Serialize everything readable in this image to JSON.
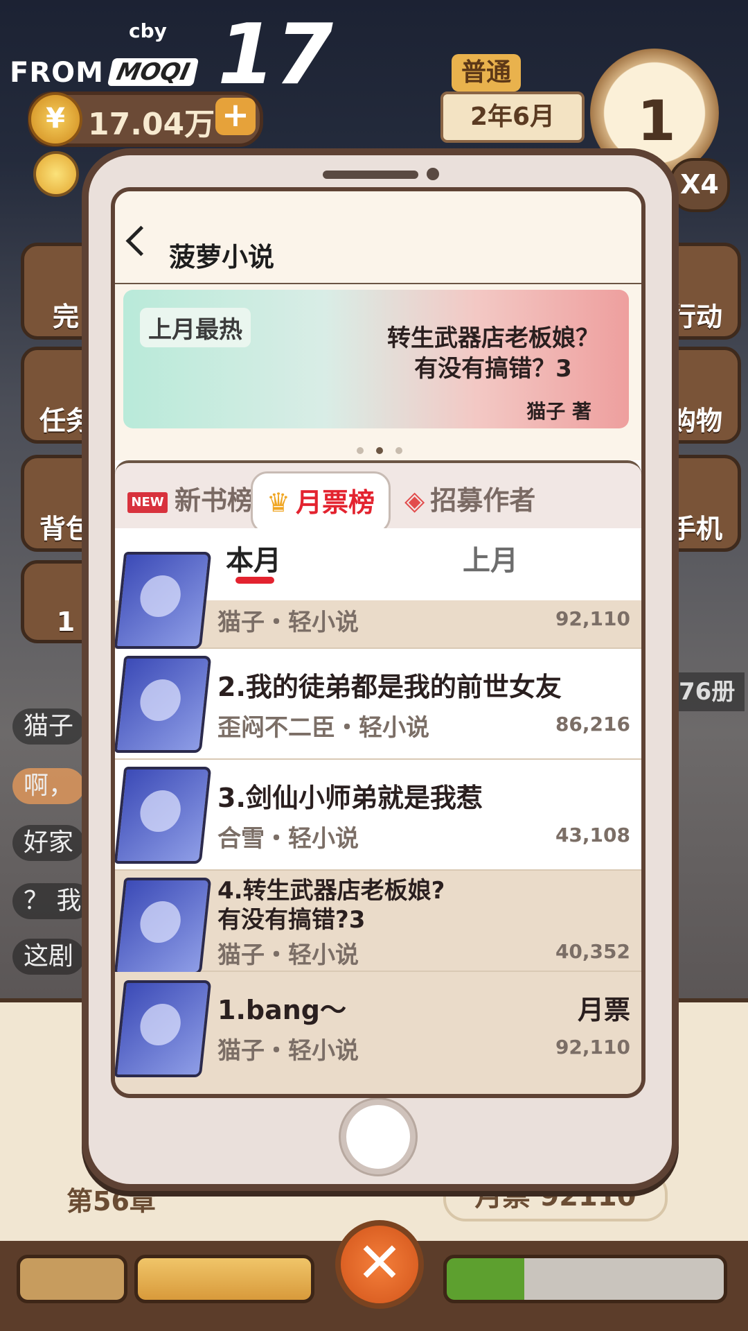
{
  "watermark": {
    "by": "cby",
    "from": "FROM",
    "brand": "MOQI",
    "num": "17"
  },
  "hud": {
    "coins": "17.04万",
    "plus": "+",
    "difficulty": "普通",
    "date": "2年6月",
    "day": "1",
    "speed": "X4"
  },
  "side_buttons": {
    "left": [
      "完",
      "任务",
      "背包",
      "1"
    ],
    "right": [
      "行动",
      "购物",
      "手机"
    ]
  },
  "chat_lines": [
    "猫子",
    "啊，",
    "好家",
    "？ 我",
    "这剧"
  ],
  "books_count": "76册",
  "bottom": {
    "chapter": "第56章",
    "monthly_votes": "月票 92110",
    "close": "✕"
  },
  "app": {
    "title": "菠萝小说",
    "banner": {
      "tag": "上月最热",
      "book_title": "转生武器店老板娘？有没有搞错？3",
      "author": "猫子 著",
      "dots": 3,
      "active_dot": 1
    },
    "tabs": [
      {
        "badge": "NEW",
        "label": "新书榜",
        "active": false
      },
      {
        "label": "月票榜",
        "active": true
      },
      {
        "label": "招募作者",
        "active": false
      }
    ],
    "subtabs": [
      {
        "label": "本月",
        "active": true
      },
      {
        "label": "上月",
        "active": false
      }
    ],
    "ranking": [
      {
        "meta": "猫子・轻小说",
        "votes": "92,110"
      },
      {
        "title": "2.我的徒弟都是我的前世女友",
        "meta": "歪闷不二臣・轻小说",
        "votes": "86,216"
      },
      {
        "title": "3.剑仙小师弟就是我惹",
        "meta": "合雪・轻小说",
        "votes": "43,108"
      },
      {
        "title": "4.转生武器店老板娘?有没有搞错?3",
        "meta": "猫子・轻小说",
        "votes": "40,352"
      },
      {
        "title": "1.bang～",
        "label": "月票",
        "meta": "猫子・轻小说",
        "votes": "92,110"
      }
    ]
  },
  "colors": {
    "accent": "#e3232f",
    "frame": "#5e4234",
    "row_tan": "#eadbc9"
  }
}
